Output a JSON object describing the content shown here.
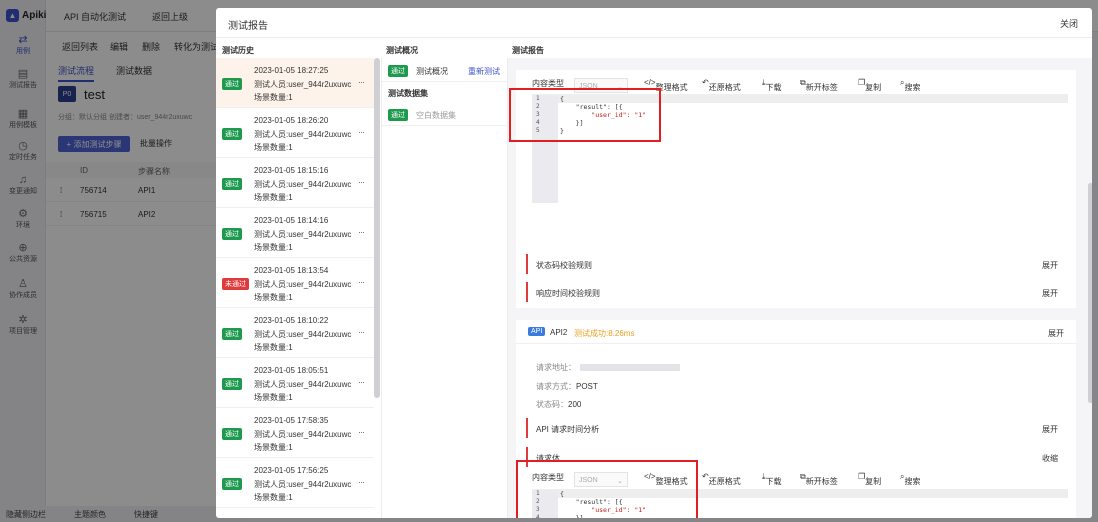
{
  "app": {
    "logo": "Apikit",
    "top_tabs": [
      "API 自动化测试",
      "返回上级"
    ],
    "sidebar": [
      {
        "label": "用例",
        "icon": "swap-icon"
      },
      {
        "label": "测试报告",
        "icon": "report-icon"
      },
      {
        "label": "用例模板",
        "icon": "template-icon"
      },
      {
        "label": "定时任务",
        "icon": "clock-icon"
      },
      {
        "label": "变更通知",
        "icon": "bell-icon"
      },
      {
        "label": "环境",
        "icon": "gear-icon"
      },
      {
        "label": "公共资源",
        "icon": "resource-icon"
      },
      {
        "label": "协作成员",
        "icon": "people-icon"
      },
      {
        "label": "项目管理",
        "icon": "settings-icon"
      }
    ],
    "toolbar": [
      "返回列表",
      "编辑",
      "删除",
      "转化为测试"
    ],
    "subtabs": [
      "测试流程",
      "测试数据"
    ],
    "project_badge": "P0",
    "project_name": "test",
    "project_meta": "分组：默认分组    创建者：user_944r2uxuwc",
    "add_step": "+ 添加测试步骤",
    "batch": "批量操作",
    "table_headers": [
      "ID",
      "步骤名称"
    ],
    "table_rows": [
      {
        "id": "756714",
        "name": "API1"
      },
      {
        "id": "756715",
        "name": "API2"
      }
    ],
    "bottom": [
      "隐藏侧边栏",
      "主题颜色",
      "快捷键"
    ]
  },
  "modal": {
    "title": "测试报告",
    "close": "关闭",
    "col_history": "测试历史",
    "col_overview": "测试概况",
    "col_report": "测试报告",
    "history": [
      {
        "status": "通过",
        "pass": true,
        "time": "2023-01-05 18:27:25",
        "who": "测试人员:user_944r2uxuwc",
        "count": "场景数量:1"
      },
      {
        "status": "通过",
        "pass": true,
        "time": "2023-01-05 18:26:20",
        "who": "测试人员:user_944r2uxuwc",
        "count": "场景数量:1"
      },
      {
        "status": "通过",
        "pass": true,
        "time": "2023-01-05 18:15:16",
        "who": "测试人员:user_944r2uxuwc",
        "count": "场景数量:1"
      },
      {
        "status": "通过",
        "pass": true,
        "time": "2023-01-05 18:14:16",
        "who": "测试人员:user_944r2uxuwc",
        "count": "场景数量:1"
      },
      {
        "status": "未通过",
        "pass": false,
        "time": "2023-01-05 18:13:54",
        "who": "测试人员:user_944r2uxuwc",
        "count": "场景数量:1"
      },
      {
        "status": "通过",
        "pass": true,
        "time": "2023-01-05 18:10:22",
        "who": "测试人员:user_944r2uxuwc",
        "count": "场景数量:1"
      },
      {
        "status": "通过",
        "pass": true,
        "time": "2023-01-05 18:05:51",
        "who": "测试人员:user_944r2uxuwc",
        "count": "场景数量:1"
      },
      {
        "status": "通过",
        "pass": true,
        "time": "2023-01-05 17:58:35",
        "who": "测试人员:user_944r2uxuwc",
        "count": "场景数量:1"
      },
      {
        "status": "通过",
        "pass": true,
        "time": "2023-01-05 17:56:25",
        "who": "测试人员:user_944r2uxuwc",
        "count": "场景数量:1"
      }
    ],
    "overview": {
      "badge": "通过",
      "label": "测试概况",
      "retest": "重新测试",
      "dataset_group": "测试数据集",
      "dataset_badge": "通过",
      "dataset_label": "空白数据集"
    },
    "report": {
      "content_type": "内容类型",
      "json": "JSON",
      "tools": [
        "整理格式",
        "还原格式",
        "下载",
        "新开标签",
        "复制",
        "搜索"
      ],
      "code_lines": [
        "{",
        "    \"result\": [{",
        "        \"user_id\": \"1\"",
        "    }]",
        "}"
      ],
      "gutter": [
        "1",
        "2",
        "3",
        "4",
        "5"
      ],
      "rule_status": "状态码校验规则",
      "rule_time": "响应时间校验规则",
      "expand": "展开",
      "collapse": "收缩",
      "api_tag": "API",
      "api_name": "API2",
      "api_result": "测试成功:8.26ms",
      "req_addr": "请求地址：",
      "req_method_label": "请求方式：",
      "req_method": "POST",
      "status_label": "状态码：",
      "status_code": "200",
      "time_analysis": "API 请求时间分析",
      "req_body": "请求体"
    }
  }
}
